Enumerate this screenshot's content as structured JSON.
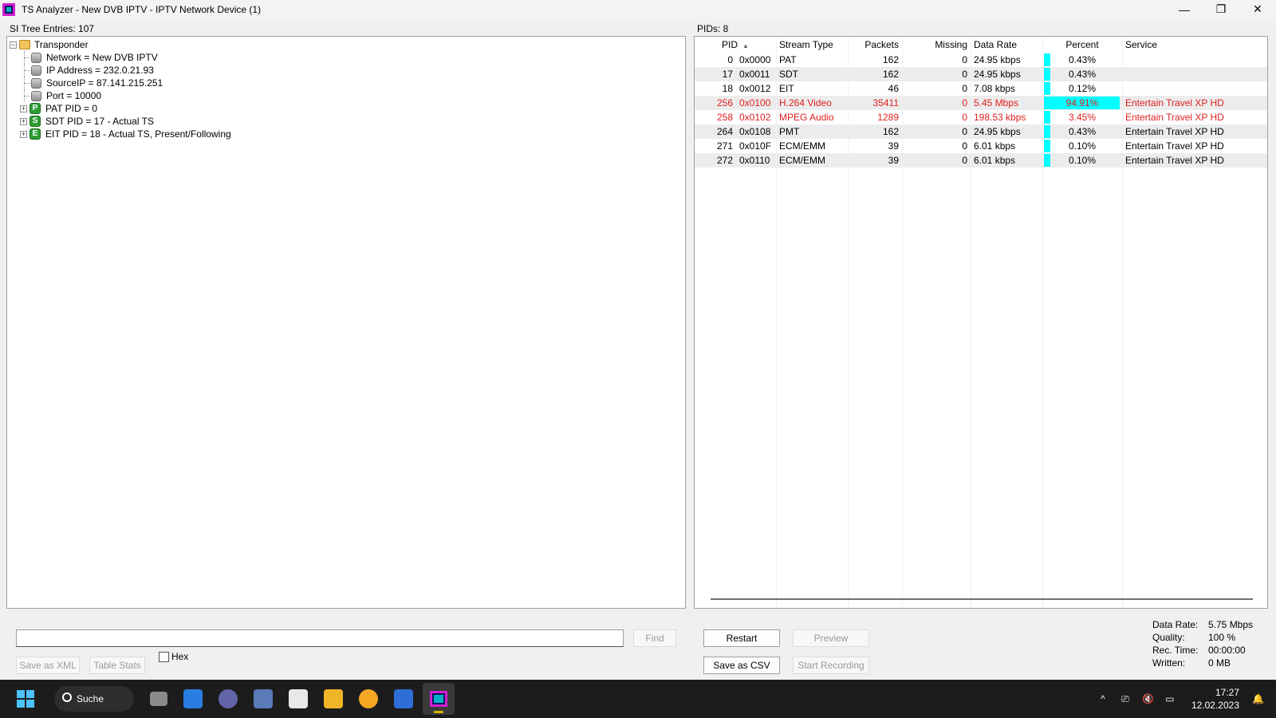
{
  "window": {
    "title": "TS Analyzer - New DVB IPTV - IPTV Network Device (1)",
    "minimize": "—",
    "maximize": "❐",
    "close": "✕"
  },
  "left": {
    "header": "SI Tree Entries: 107",
    "tree": {
      "root": "Transponder",
      "root_expander": "−",
      "children": [
        "Network = New DVB IPTV",
        "IP Address = 232.0.21.93",
        "SourceIP = 87.141.215.251",
        "Port = 10000"
      ],
      "pids": [
        {
          "letter": "P",
          "label": "PAT PID = 0",
          "expander": "+"
        },
        {
          "letter": "S",
          "label": "SDT PID = 17 - Actual TS",
          "expander": "+"
        },
        {
          "letter": "E",
          "label": "EIT PID = 18 - Actual TS, Present/Following",
          "expander": "+"
        }
      ]
    },
    "find_value": "",
    "find_label": "Find",
    "save_xml_label": "Save as XML",
    "table_stats_label": "Table Stats",
    "hex_label": "Hex"
  },
  "right": {
    "header": "PIDs: 8",
    "columns": {
      "pid": "PID",
      "stream_type": "Stream Type",
      "packets": "Packets",
      "missing": "Missing",
      "data_rate": "Data Rate",
      "percent": "Percent",
      "service": "Service",
      "sort_indicator": "▲"
    },
    "rows": [
      {
        "pid": "0",
        "hex": "0x0000",
        "type": "PAT",
        "packets": "162",
        "missing": "0",
        "rate": "24.95 kbps",
        "percent": "0.43%",
        "pct_value": 0.43,
        "service": ""
      },
      {
        "pid": "17",
        "hex": "0x0011",
        "type": "SDT",
        "packets": "162",
        "missing": "0",
        "rate": "24.95 kbps",
        "percent": "0.43%",
        "pct_value": 0.43,
        "service": ""
      },
      {
        "pid": "18",
        "hex": "0x0012",
        "type": "EIT",
        "packets": "46",
        "missing": "0",
        "rate": "7.08 kbps",
        "percent": "0.12%",
        "pct_value": 0.12,
        "service": ""
      },
      {
        "pid": "256",
        "hex": "0x0100",
        "type": "H.264 Video",
        "packets": "35411",
        "missing": "0",
        "rate": "5.45 Mbps",
        "percent": "94.91%",
        "pct_value": 94.91,
        "service": "Entertain Travel XP HD",
        "highlight": true
      },
      {
        "pid": "258",
        "hex": "0x0102",
        "type": "MPEG Audio",
        "packets": "1289",
        "missing": "0",
        "rate": "198.53 kbps",
        "percent": "3.45%",
        "pct_value": 3.45,
        "service": "Entertain Travel XP HD",
        "highlight": true
      },
      {
        "pid": "264",
        "hex": "0x0108",
        "type": "PMT",
        "packets": "162",
        "missing": "0",
        "rate": "24.95 kbps",
        "percent": "0.43%",
        "pct_value": 0.43,
        "service": "Entertain Travel XP HD"
      },
      {
        "pid": "271",
        "hex": "0x010F",
        "type": "ECM/EMM",
        "packets": "39",
        "missing": "0",
        "rate": "6.01 kbps",
        "percent": "0.10%",
        "pct_value": 0.1,
        "service": "Entertain Travel XP HD"
      },
      {
        "pid": "272",
        "hex": "0x0110",
        "type": "ECM/EMM",
        "packets": "39",
        "missing": "0",
        "rate": "6.01 kbps",
        "percent": "0.10%",
        "pct_value": 0.1,
        "service": "Entertain Travel XP HD"
      }
    ],
    "restart_label": "Restart",
    "preview_label": "Preview",
    "save_csv_label": "Save as CSV",
    "start_recording_label": "Start Recording"
  },
  "stats": {
    "data_rate_key": "Data Rate:",
    "data_rate_val": "5.75 Mbps",
    "quality_key": "Quality:",
    "quality_val": "100 %",
    "rec_time_key": "Rec. Time:",
    "rec_time_val": "00:00:00",
    "written_key": "Written:",
    "written_val": "0 MB"
  },
  "taskbar": {
    "search_label": "Suche",
    "time": "17:27",
    "date": "12.02.2023",
    "tray_chevron": "^",
    "tray_network": "⎚",
    "tray_volume": "🔇",
    "tray_battery": "▭",
    "tray_notify": "🔔"
  },
  "colors": {
    "highlight_text": "#e02020",
    "percent_bar": "#00ffff",
    "alt_row": "#ececec",
    "taskbar": "#1c1c1c"
  }
}
